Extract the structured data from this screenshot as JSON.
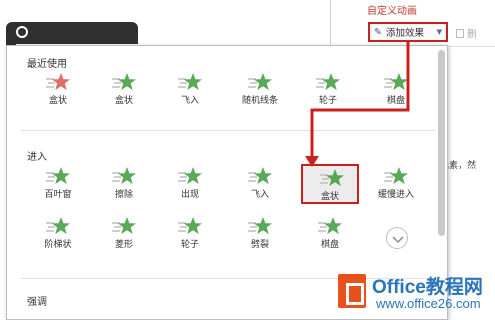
{
  "background": {
    "pane_title": "自定义动画",
    "pane_side_text": "个元素，然"
  },
  "toolbar": {
    "add_effect_label": "添加效果",
    "delete_label": "删"
  },
  "colors": {
    "highlight_red": "#c9211e",
    "star_green": "#3c9a3c",
    "star_red": "#d9534f",
    "watermark_blue": "#2a74b8",
    "watermark_orange": "#e8511c"
  },
  "dropdown": {
    "sections": [
      {
        "title": "最近使用",
        "effects": [
          {
            "label": "盒状",
            "icon": "star-red-icon"
          },
          {
            "label": "盒状",
            "icon": "star-green-icon"
          },
          {
            "label": "飞入",
            "icon": "star-green-icon"
          },
          {
            "label": "随机线条",
            "icon": "star-green-icon"
          },
          {
            "label": "轮子",
            "icon": "star-green-icon"
          },
          {
            "label": "棋盘",
            "icon": "star-green-icon"
          }
        ]
      },
      {
        "title": "进入",
        "effects": [
          {
            "label": "百叶窗",
            "icon": "star-green-icon"
          },
          {
            "label": "擦除",
            "icon": "star-green-icon"
          },
          {
            "label": "出现",
            "icon": "star-green-icon"
          },
          {
            "label": "飞入",
            "icon": "star-green-icon"
          },
          {
            "label": "盒状",
            "icon": "star-green-icon",
            "selected": true
          },
          {
            "label": "缓慢进入",
            "icon": "star-green-icon"
          },
          {
            "label": "阶梯状",
            "icon": "star-green-icon"
          },
          {
            "label": "菱形",
            "icon": "star-green-icon"
          },
          {
            "label": "轮子",
            "icon": "star-green-icon"
          },
          {
            "label": "劈裂",
            "icon": "star-green-icon"
          },
          {
            "label": "棋盘",
            "icon": "star-green-icon"
          }
        ]
      },
      {
        "title": "强调",
        "effects": []
      }
    ],
    "more_icon": "chevron-down-icon"
  },
  "watermark": {
    "name": "Office教程网",
    "url": "www.office26.com"
  }
}
